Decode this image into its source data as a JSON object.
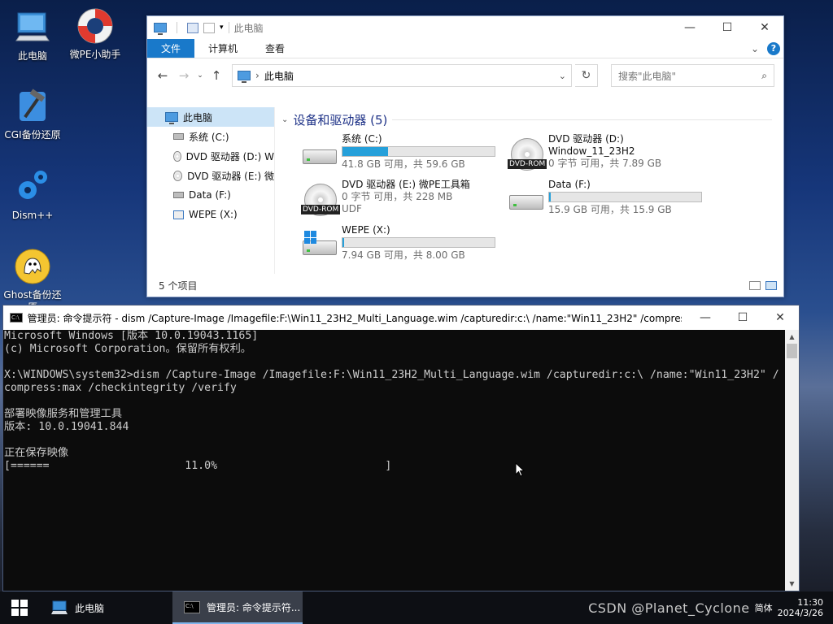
{
  "desktop": {
    "icons": [
      {
        "label": "此电脑",
        "icon": "computer-icon"
      },
      {
        "label": "微PE小助手",
        "icon": "lifebuoy-icon"
      },
      {
        "label": "CGI备份还原",
        "icon": "hammer-icon"
      },
      {
        "label": "Dism++",
        "icon": "gears-icon"
      },
      {
        "label": "Ghost备份还原",
        "icon": "ghost-icon"
      }
    ]
  },
  "explorer": {
    "title": "此电脑",
    "ribbon_tabs": [
      "文件",
      "计算机",
      "查看"
    ],
    "address": "此电脑",
    "search_placeholder": "搜索\"此电脑\"",
    "sidebar": [
      {
        "label": "此电脑"
      },
      {
        "label": "系统 (C:)"
      },
      {
        "label": "DVD 驱动器 (D:) W"
      },
      {
        "label": "DVD 驱动器 (E:) 微"
      },
      {
        "label": "Data (F:)"
      },
      {
        "label": "WEPE (X:)"
      }
    ],
    "group_title": "设备和驱动器 (5)",
    "drives": [
      {
        "name": "系统 (C:)",
        "usage": 0.3,
        "info": "41.8 GB 可用，共 59.6 GB"
      },
      {
        "name": "DVD 驱动器 (D:)",
        "name2": "Window_11_23H2",
        "info": "0 字节 可用，共 7.89 GB",
        "badge": "DVD-ROM"
      },
      {
        "name": "DVD 驱动器 (E:) 微PE工具箱",
        "info": "0 字节 可用，共 228 MB",
        "info2": "UDF",
        "badge": "DVD-ROM"
      },
      {
        "name": "Data (F:)",
        "usage": 0.01,
        "info": "15.9 GB 可用，共 15.9 GB"
      },
      {
        "name": "WEPE (X:)",
        "usage": 0.01,
        "info": "7.94 GB 可用，共 8.00 GB"
      }
    ],
    "status": "5 个项目"
  },
  "cmd": {
    "title": "管理员: 命令提示符 - dism  /Capture-Image /Imagefile:F:\\Win11_23H2_Multi_Language.wim /capturedir:c:\\ /name:\"Win11_23H2\" /compress:...",
    "lines": [
      "Microsoft Windows [版本 10.0.19043.1165]",
      "(c) Microsoft Corporation。保留所有权利。",
      "",
      "X:\\WINDOWS\\system32>dism /Capture-Image /Imagefile:F:\\Win11_23H2_Multi_Language.wim /capturedir:c:\\ /name:\"Win11_23H2\" /",
      "compress:max /checkintegrity /verify",
      "",
      "部署映像服务和管理工具",
      "版本: 10.0.19041.844",
      "",
      "正在保存映像",
      "[======                     11.0%                          ]"
    ]
  },
  "taskbar": {
    "items": [
      {
        "label": "此电脑"
      },
      {
        "label": "管理员: 命令提示符..."
      }
    ],
    "watermark": "CSDN @Planet_Cyclone",
    "ime": "简体",
    "time": "11:30",
    "date": "2024/3/26"
  }
}
